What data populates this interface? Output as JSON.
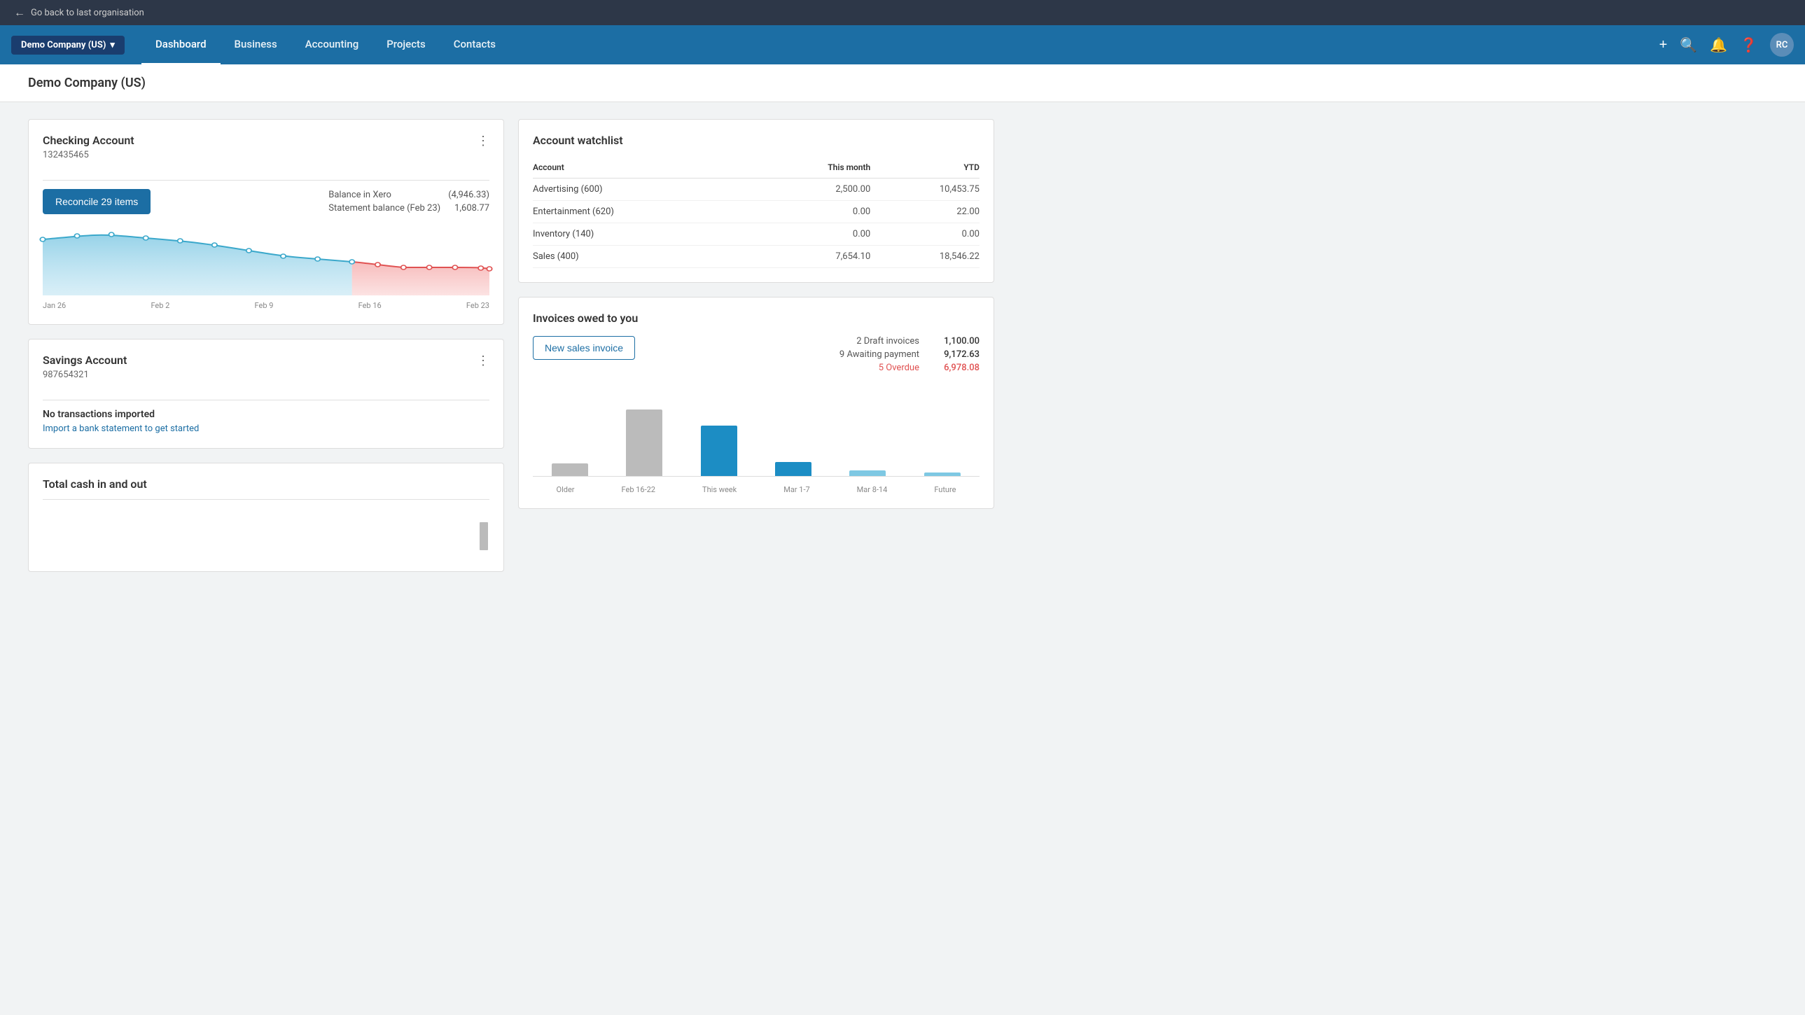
{
  "topbar": {
    "back_label": "Go back to last organisation"
  },
  "nav": {
    "company_name": "Demo Company (US)",
    "links": [
      {
        "label": "Dashboard",
        "active": true
      },
      {
        "label": "Business",
        "active": false
      },
      {
        "label": "Accounting",
        "active": false
      },
      {
        "label": "Projects",
        "active": false
      },
      {
        "label": "Contacts",
        "active": false
      }
    ],
    "avatar_initials": "RC"
  },
  "page": {
    "title": "Demo Company (US)"
  },
  "checking_account": {
    "title": "Checking Account",
    "account_number": "132435465",
    "reconcile_label": "Reconcile 29 items",
    "balance_in_xero_label": "Balance in Xero",
    "balance_in_xero_value": "(4,946.33)",
    "statement_balance_label": "Statement balance (Feb 23)",
    "statement_balance_value": "1,608.77",
    "chart_labels": [
      "Jan 26",
      "Feb 2",
      "Feb 9",
      "Feb 16",
      "Feb 23"
    ]
  },
  "savings_account": {
    "title": "Savings Account",
    "account_number": "987654321",
    "no_transactions_label": "No transactions imported",
    "import_link_label": "Import a bank statement to get started"
  },
  "total_cash": {
    "title": "Total cash in and out"
  },
  "account_watchlist": {
    "title": "Account watchlist",
    "col_account": "Account",
    "col_this_month": "This month",
    "col_ytd": "YTD",
    "rows": [
      {
        "account": "Advertising (600)",
        "this_month": "2,500.00",
        "ytd": "10,453.75"
      },
      {
        "account": "Entertainment (620)",
        "this_month": "0.00",
        "ytd": "22.00"
      },
      {
        "account": "Inventory (140)",
        "this_month": "0.00",
        "ytd": "0.00"
      },
      {
        "account": "Sales (400)",
        "this_month": "7,654.10",
        "ytd": "18,546.22"
      }
    ]
  },
  "invoices_owed": {
    "title": "Invoices owed to you",
    "new_invoice_label": "New sales invoice",
    "draft_label": "2 Draft invoices",
    "draft_value": "1,100.00",
    "awaiting_label": "9 Awaiting payment",
    "awaiting_value": "9,172.63",
    "overdue_label": "5 Overdue",
    "overdue_value": "6,978.08",
    "bar_labels": [
      "Older",
      "Feb 16-22",
      "This week",
      "Mar 1-7",
      "Mar 8-14",
      "Future"
    ],
    "bar_heights": [
      18,
      95,
      72,
      20,
      8,
      5
    ],
    "bar_colors": [
      "gray",
      "gray",
      "blue",
      "blue",
      "light-blue",
      "light-blue"
    ]
  }
}
